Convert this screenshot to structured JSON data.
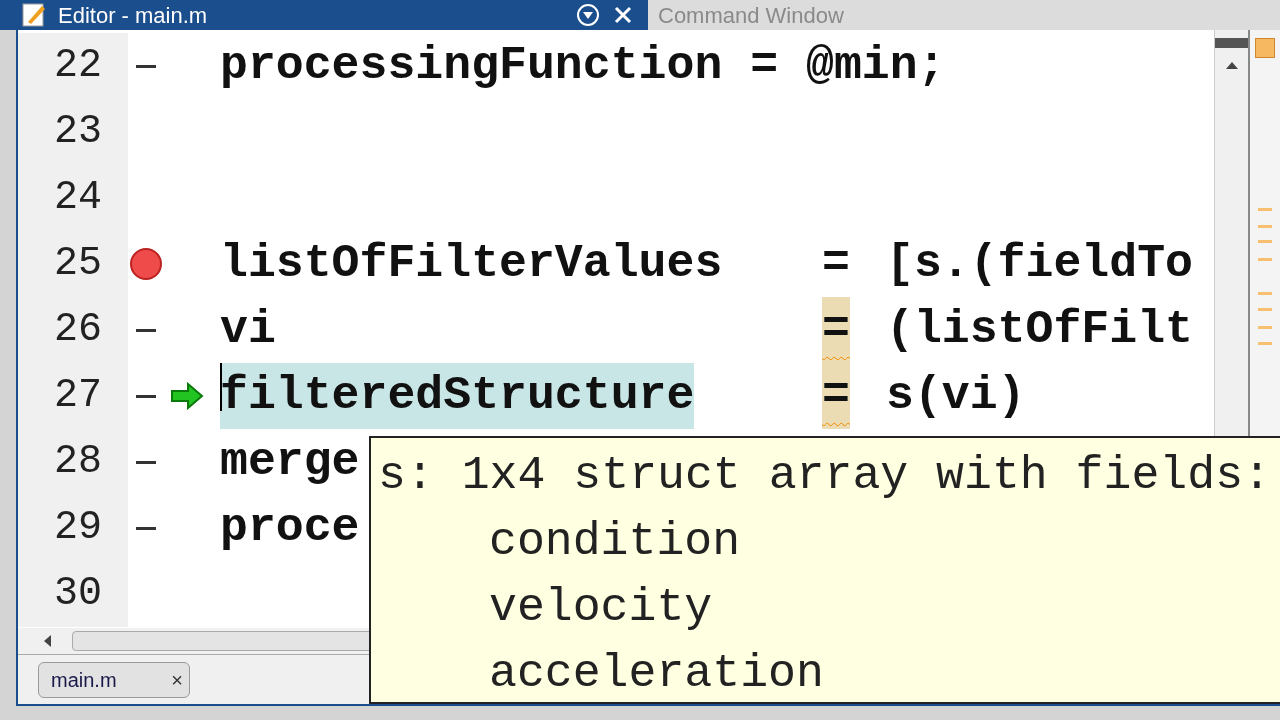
{
  "tabs": [
    {
      "label": "Editor - main.m",
      "selected": true
    },
    {
      "label": "Command Window",
      "selected": false
    }
  ],
  "lines": [
    {
      "number": "22",
      "executable": true,
      "breakpoint": false,
      "current": false,
      "kind": "plain",
      "code": "processingFunction = @min;"
    },
    {
      "number": "23",
      "executable": false,
      "breakpoint": false,
      "current": false,
      "kind": "plain"
    },
    {
      "number": "24",
      "executable": false,
      "breakpoint": false,
      "current": false,
      "kind": "plain"
    },
    {
      "number": "25",
      "executable": true,
      "breakpoint": true,
      "current": false,
      "kind": "aligned",
      "lhs": "listOfFilterValues",
      "lhs_selected": false,
      "op": "=",
      "op_warned": false,
      "rhs": "[s.(fieldTo"
    },
    {
      "number": "26",
      "executable": true,
      "breakpoint": false,
      "current": false,
      "kind": "aligned",
      "lhs": "vi",
      "lhs_selected": false,
      "op": "=",
      "op_warned": true,
      "rhs": "(listOfFilt"
    },
    {
      "number": "27",
      "executable": true,
      "breakpoint": false,
      "current": true,
      "kind": "aligned",
      "lhs": "filteredStructure",
      "lhs_selected": true,
      "op": "=",
      "op_warned": true,
      "rhs": "s(vi)"
    },
    {
      "number": "28",
      "executable": true,
      "breakpoint": false,
      "current": false,
      "kind": "plain",
      "code": "merge"
    },
    {
      "number": "29",
      "executable": true,
      "breakpoint": false,
      "current": false,
      "kind": "plain",
      "code": "proce"
    },
    {
      "number": "30",
      "executable": false,
      "breakpoint": false,
      "current": false,
      "kind": "plain"
    }
  ],
  "tooltip": {
    "title": "s: 1x4 struct array with fields:",
    "fields": [
      "condition",
      "velocity",
      "acceleration"
    ]
  },
  "file_tabs": [
    {
      "label": "main.m",
      "close": "×"
    }
  ]
}
